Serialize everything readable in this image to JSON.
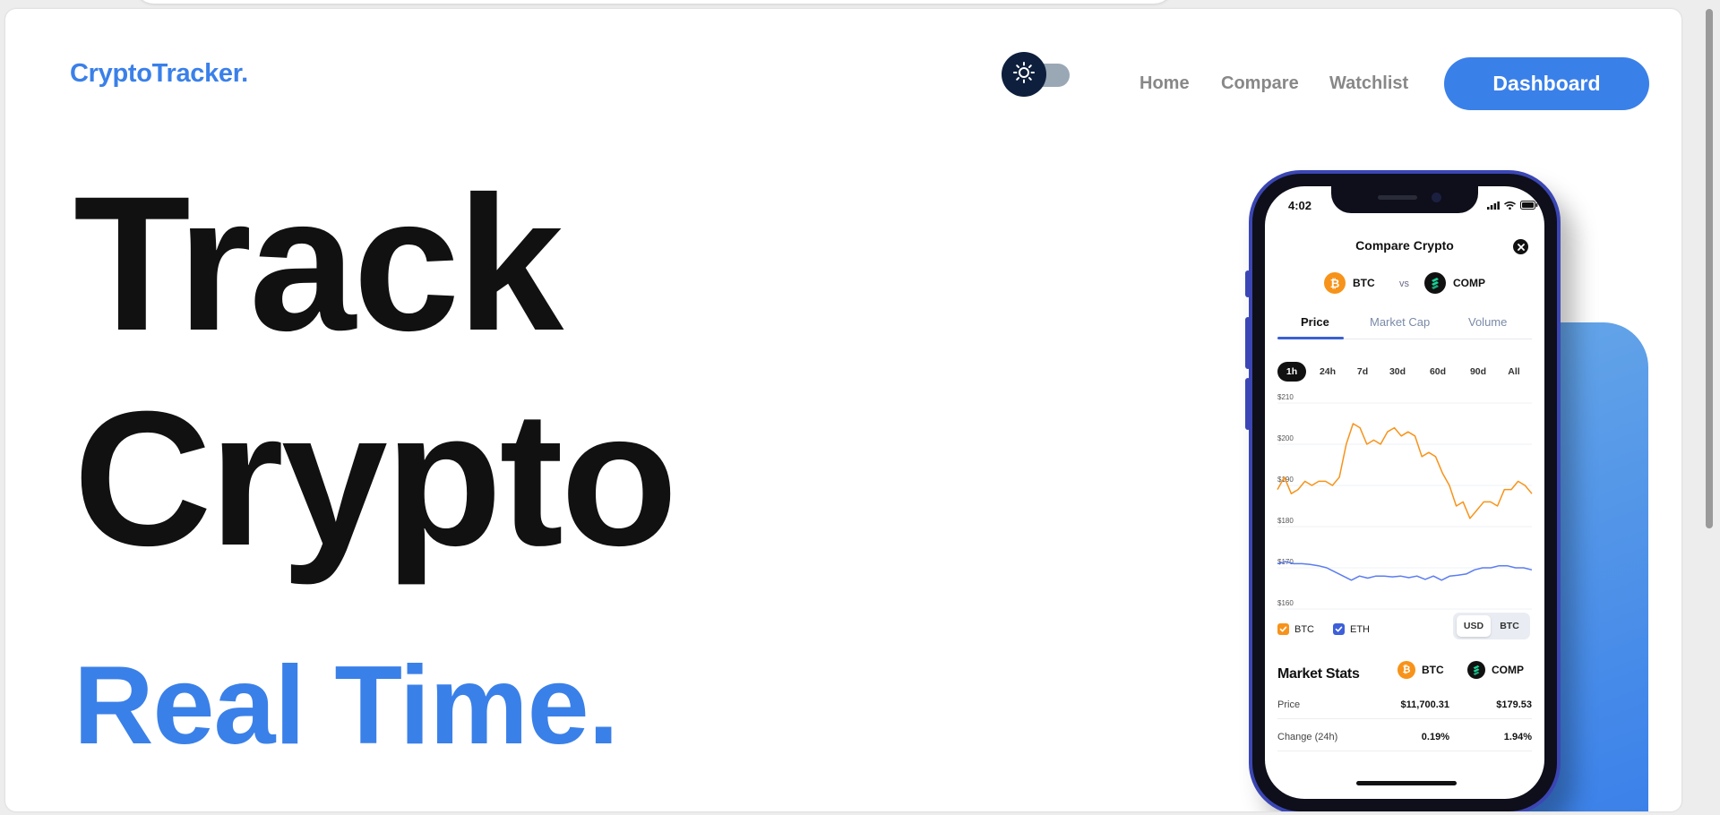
{
  "header": {
    "logo": "CryptoTracker.",
    "theme_toggle_icon": "sun-icon",
    "nav": [
      "Home",
      "Compare",
      "Watchlist"
    ],
    "cta": "Dashboard"
  },
  "hero": {
    "line1": "Track",
    "line2": "Crypto",
    "line3": "Real Time."
  },
  "colors": {
    "accent": "#3a80e9",
    "btc_orange": "#f7931a",
    "eth_blue": "#5b7cf0",
    "dark": "#0d1f3d"
  },
  "phone": {
    "time": "4:02",
    "title": "Compare Crypto",
    "coin_a": "BTC",
    "coin_b": "COMP",
    "vs": "vs",
    "tabs": [
      "Price",
      "Market Cap",
      "Volume"
    ],
    "active_tab": "Price",
    "ranges": [
      "1h",
      "24h",
      "7d",
      "30d",
      "60d",
      "90d",
      "All"
    ],
    "active_range": "1h",
    "legend": [
      "BTC",
      "ETH"
    ],
    "currency": [
      "USD",
      "BTC"
    ],
    "active_currency": "USD",
    "market_stats": {
      "title": "Market Stats",
      "coin_a": "BTC",
      "coin_b": "COMP",
      "rows": [
        {
          "label": "Price",
          "a": "$11,700.31",
          "b": "$179.53"
        },
        {
          "label": "Change (24h)",
          "a": "0.19%",
          "b": "1.94%"
        }
      ]
    }
  },
  "chart_data": {
    "type": "line",
    "title": "",
    "xlabel": "",
    "ylabel": "",
    "ylim": [
      160,
      210
    ],
    "yticks": [
      "$210",
      "$200",
      "$190",
      "$180",
      "$170",
      "$160"
    ],
    "grid": true,
    "legend_placement": "bottom-left",
    "series": [
      {
        "name": "BTC",
        "color": "#f7931a",
        "values": [
          189,
          192,
          188,
          189,
          191,
          190,
          191,
          191,
          190,
          192,
          200,
          205,
          204,
          200,
          201,
          200,
          203,
          204,
          202,
          203,
          202,
          197,
          198,
          197,
          193,
          190,
          185,
          186,
          182,
          184,
          186,
          186,
          185,
          189,
          189,
          191,
          190,
          188
        ]
      },
      {
        "name": "ETH",
        "color": "#5b7cf0",
        "values": [
          171,
          171.5,
          171,
          171,
          170.8,
          170.5,
          170,
          169,
          168,
          167,
          168,
          167.5,
          168,
          168,
          167.8,
          168,
          167.6,
          168,
          167.2,
          168,
          167,
          168,
          168.2,
          168.5,
          169.5,
          170,
          170,
          170.5,
          170.5,
          170,
          170,
          169.5
        ]
      }
    ]
  }
}
